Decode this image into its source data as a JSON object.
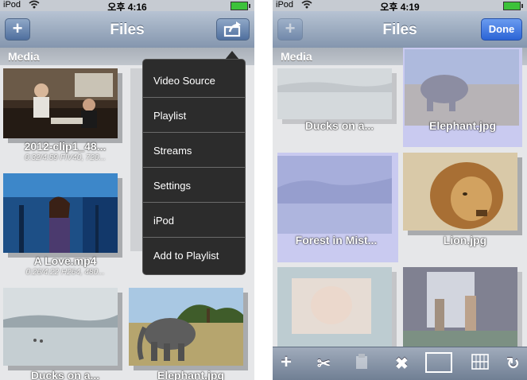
{
  "left": {
    "status": {
      "carrier": "iPod",
      "time": "오후 4:16"
    },
    "nav": {
      "title": "Files",
      "add_label": "+"
    },
    "section": "Media",
    "items": [
      {
        "title": "2012-clip1_48...",
        "meta": "0:32/4:59 FIV40, 720..."
      },
      {
        "title": "A Love.mp4",
        "meta": "0:26/4:22 H264, 480..."
      },
      {
        "title": "Ducks on a...",
        "meta": ""
      },
      {
        "title": "Elephant.jpg",
        "meta": ""
      }
    ],
    "menu": [
      "Video Source",
      "Playlist",
      "Streams",
      "Settings",
      "iPod",
      "Add to Playlist"
    ]
  },
  "right": {
    "status": {
      "carrier": "iPod",
      "time": "오후 4:19"
    },
    "nav": {
      "title": "Files",
      "add_label": "+",
      "done_label": "Done"
    },
    "section": "Media",
    "items": [
      {
        "title": "Ducks on a..."
      },
      {
        "title": "Elephant.jpg"
      },
      {
        "title": "Forest in Mist..."
      },
      {
        "title": "Lion.jpg"
      }
    ],
    "toolbar": [
      "add-icon",
      "cut-icon",
      "paste-icon",
      "delete-icon",
      "folder-icon",
      "grid-icon",
      "refresh-icon"
    ]
  }
}
